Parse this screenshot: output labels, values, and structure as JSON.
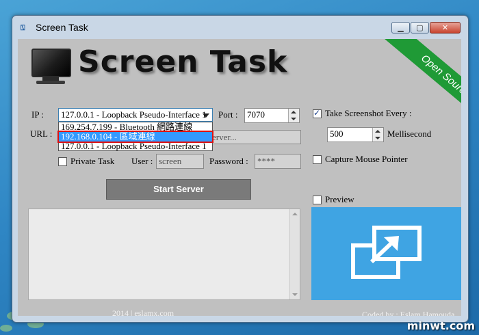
{
  "window": {
    "title": "Screen Task",
    "icon": "screen-task-app-icon",
    "controls": {
      "minimize": "▁",
      "maximize": "▢",
      "close": "✕"
    }
  },
  "banner": {
    "logo_text": "Screen Task",
    "ribbon": "Open Source"
  },
  "form": {
    "ip_label": "IP :",
    "ip_selected": "127.0.0.1 - Loopback Pseudo-Interface 1",
    "ip_options": [
      "169.254.7.199 - Bluetooth 網路連線",
      "192.168.0.104 - 區域連線",
      "127.0.0.1 - Loopback Pseudo-Interface 1"
    ],
    "ip_highlighted_index": 1,
    "port_label": "Port :",
    "port_value": "7070",
    "url_label": "URL :",
    "url_value": "erver...",
    "private_task_label": "Private Task",
    "private_task_checked": false,
    "user_label": "User :",
    "user_placeholder": "screen",
    "password_label": "Password :",
    "password_value": "****",
    "take_screenshot_label": "Take Screenshot Every :",
    "take_screenshot_checked": true,
    "interval_value": "500",
    "interval_unit": "Mellisecond",
    "capture_mouse_label": "Capture Mouse Pointer",
    "capture_mouse_checked": false,
    "preview_label": "Preview",
    "preview_checked": false,
    "start_button": "Start Server"
  },
  "footer": {
    "copyright": "2014 | eslamx.com",
    "credit": "Coded by : Eslam Hamouda"
  },
  "watermark": "minwt.com",
  "colors": {
    "preview_bg": "#3fa4e3",
    "ribbon": "#1f9a36",
    "selection": "#3399ff",
    "highlight_border": "#e01010"
  }
}
